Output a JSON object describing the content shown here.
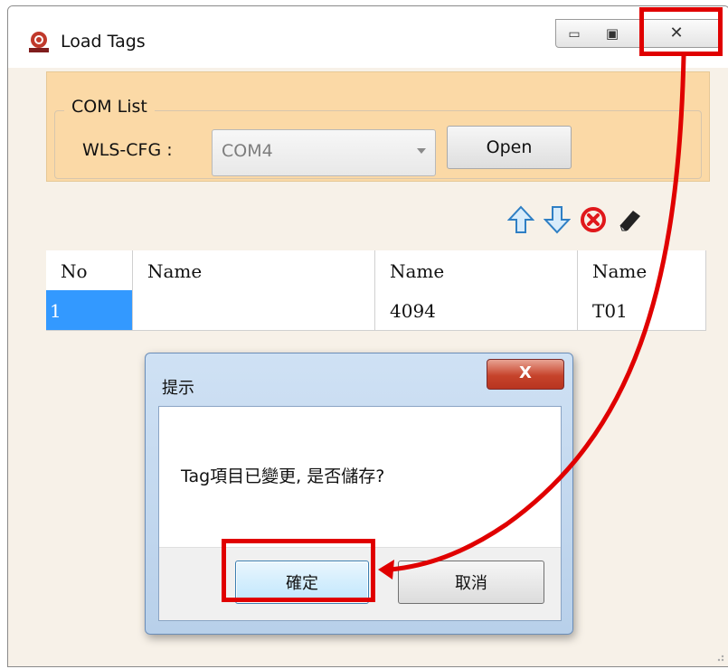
{
  "window": {
    "title": "Load Tags",
    "min_glyph": "▭",
    "max_glyph": "▣",
    "close_glyph": "✕"
  },
  "com_list": {
    "legend": "COM List",
    "wls_label": "WLS-CFG :",
    "combo_value": "COM4",
    "open_label": "Open"
  },
  "toolbar": {
    "icons": [
      "up-arrow-icon",
      "down-arrow-icon",
      "delete-icon",
      "eraser-icon"
    ]
  },
  "grid": {
    "headers": [
      "No",
      "Name",
      "Name",
      "Name"
    ],
    "rows": [
      [
        "1",
        "",
        "4094",
        "T01"
      ]
    ]
  },
  "dialog": {
    "title": "提示",
    "close_glyph": "X",
    "message": "Tag項目已變更, 是否儲存?",
    "ok_label": "確定",
    "cancel_label": "取消"
  },
  "colors": {
    "highlight": "#e00000",
    "panel": "#fbd9a6",
    "selection": "#3399ff"
  }
}
